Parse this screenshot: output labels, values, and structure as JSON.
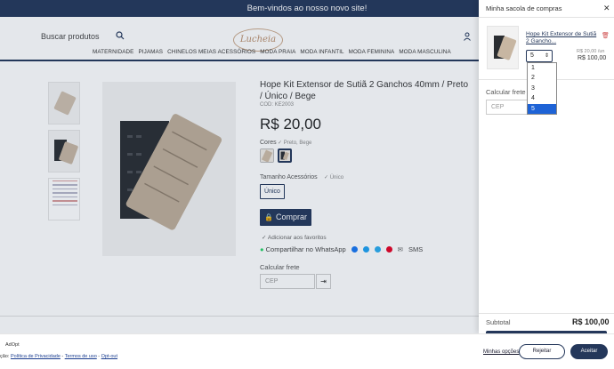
{
  "topbar": {
    "welcome": "Bem-vindos ao nosso novo site!"
  },
  "header": {
    "search_placeholder": "Buscar produtos",
    "logo_text": "Lucheia",
    "nav": [
      "MATERNIDADE",
      "PIJAMAS",
      "CHINELOS MEIAS ACESSÓRIOS",
      "MODA PRAIA",
      "MODA INFANTIL",
      "MODA FEMININA",
      "MODA MASCULINA"
    ]
  },
  "product": {
    "title": "Hope Kit Extensor de Sutiã 2 Ganchos 40mm / Preto / Único / Bege",
    "code": "COD: KE2003",
    "price": "R$ 20,00",
    "cores_label": "Cores",
    "cores_value": "Preto, Bege",
    "tamanho_label": "Tamanho Acessórios",
    "tamanho_value": "Único",
    "size_option": "Único",
    "buy_label": "Comprar",
    "favorite_label": "Adicionar aos favoritos",
    "whatsapp_label": "Compartilhar no WhatsApp",
    "sms_label": "SMS",
    "frete_label": "Calcular frete",
    "cep_placeholder": "CEP"
  },
  "cart": {
    "title": "Minha sacola de compras",
    "item_name": "Hope Kit Extensor de Sutiã 2 Gancho...",
    "qty": "5",
    "qty_options": [
      "1",
      "2",
      "3",
      "4",
      "5"
    ],
    "unit_price": "R$ 20,00 /un",
    "line_total": "R$ 100,00",
    "frete_label": "Calcular frete",
    "cep_placeholder": "CEP",
    "subtotal_label": "Subtotal",
    "subtotal_value": "R$ 100,00"
  },
  "consent": {
    "brand": "AdOpt",
    "prefix": "ção:",
    "privacy": "Política de Privacidade",
    "terms": "Termos de uso",
    "optout": "Opt-out",
    "options": "Minhas opções",
    "reject": "Rejeitar",
    "accept": "Aceitar"
  },
  "colors": {
    "primary": "#24375a",
    "dropdown_highlight": "#1e63d6"
  }
}
